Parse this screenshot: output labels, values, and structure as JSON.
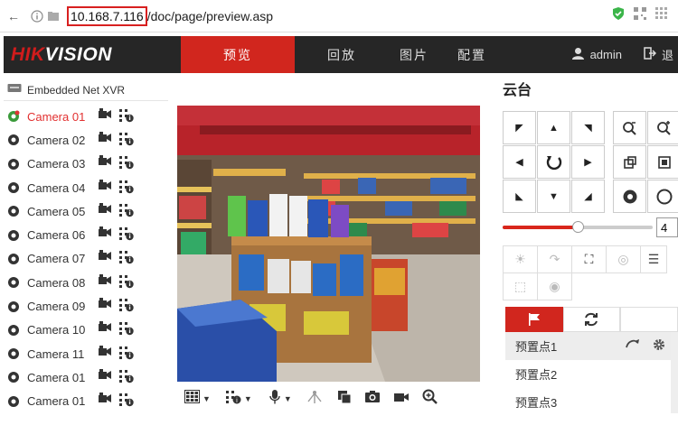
{
  "browser": {
    "url_host": "10.168.7.116",
    "url_path": "/doc/page/preview.asp"
  },
  "nav": {
    "logo_red": "HIK",
    "logo_white": "VISION",
    "tabs": [
      {
        "label": "预览",
        "active": true
      },
      {
        "label": "回放",
        "active": false
      },
      {
        "label": "图片",
        "active": false
      },
      {
        "label": "配置",
        "active": false
      }
    ],
    "user": "admin",
    "accent": "#d1261e"
  },
  "device": {
    "root_label": "Embedded Net XVR",
    "cameras": [
      {
        "name": "Camera 01",
        "active": true
      },
      {
        "name": "Camera 02",
        "active": false
      },
      {
        "name": "Camera 03",
        "active": false
      },
      {
        "name": "Camera 04",
        "active": false
      },
      {
        "name": "Camera 05",
        "active": false
      },
      {
        "name": "Camera 06",
        "active": false
      },
      {
        "name": "Camera 07",
        "active": false
      },
      {
        "name": "Camera 08",
        "active": false
      },
      {
        "name": "Camera 09",
        "active": false
      },
      {
        "name": "Camera 10",
        "active": false
      },
      {
        "name": "Camera 11",
        "active": false
      },
      {
        "name": "Camera 01",
        "active": false
      },
      {
        "name": "Camera 01",
        "active": false
      }
    ]
  },
  "ptz": {
    "title": "云台",
    "speed_value": "4",
    "speed_level": 0.5
  },
  "presets": {
    "items": [
      "预置点1",
      "预置点2",
      "预置点3"
    ]
  }
}
